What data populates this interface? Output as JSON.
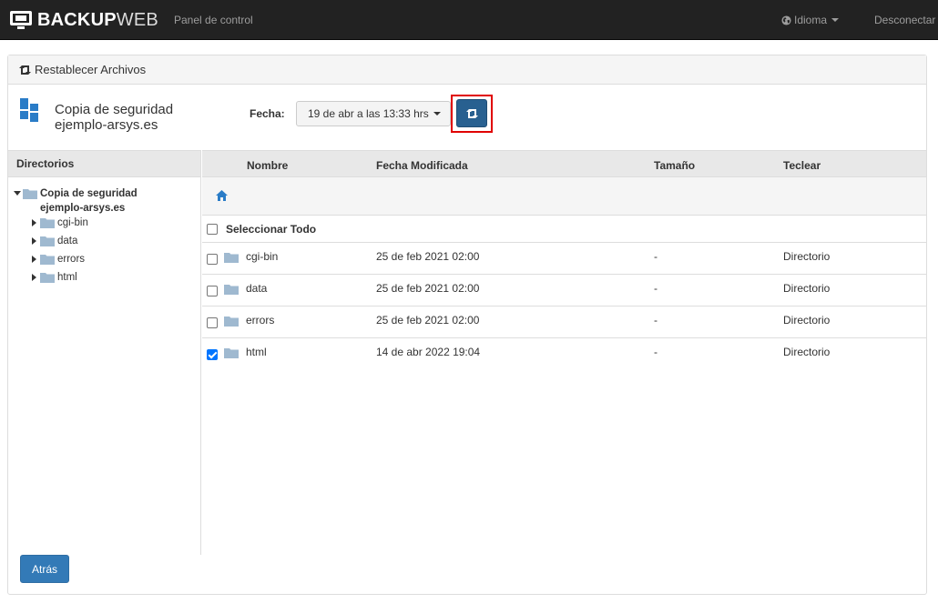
{
  "navbar": {
    "brand_bold": "BACKUP",
    "brand_light": "WEB",
    "panel_link": "Panel de control",
    "language_label": "Idioma",
    "logout_label": "Desconectar"
  },
  "panel": {
    "title": "Restablecer Archivos",
    "backup_title_line1": "Copia de seguridad",
    "backup_title_line2": "ejemplo-arsys.es",
    "date_label": "Fecha:",
    "date_selected": "19 de abr a las 13:33 hrs"
  },
  "directories": {
    "header": "Directorios",
    "root_line1": "Copia de seguridad",
    "root_line2": "ejemplo-arsys.es",
    "items": [
      {
        "label": "cgi-bin"
      },
      {
        "label": "data"
      },
      {
        "label": "errors"
      },
      {
        "label": "html"
      }
    ]
  },
  "files": {
    "columns": [
      "Nombre",
      "Fecha Modificada",
      "Tamaño",
      "Teclear"
    ],
    "select_all_label": "Seleccionar Todo",
    "rows": [
      {
        "name": "cgi-bin",
        "modified": "25 de feb 2021 02:00",
        "size": "-",
        "type": "Directorio",
        "checked": false
      },
      {
        "name": "data",
        "modified": "25 de feb 2021 02:00",
        "size": "-",
        "type": "Directorio",
        "checked": false
      },
      {
        "name": "errors",
        "modified": "25 de feb 2021 02:00",
        "size": "-",
        "type": "Directorio",
        "checked": false
      },
      {
        "name": "html",
        "modified": "14 de abr 2022 19:04",
        "size": "-",
        "type": "Directorio",
        "checked": true
      }
    ]
  },
  "back_label": "Atrás",
  "icons": {
    "brand": "monitor-logo-icon",
    "language": "globe-icon",
    "restore": "retweet-icon",
    "backup": "windows-blocks-icon",
    "folder": "folder-icon",
    "home": "home-icon"
  },
  "colors": {
    "navbar": "#222222",
    "primary": "#337ab7",
    "highlight": "#e00000",
    "folder": "#9fb9d0",
    "home": "#2a7cc7"
  }
}
